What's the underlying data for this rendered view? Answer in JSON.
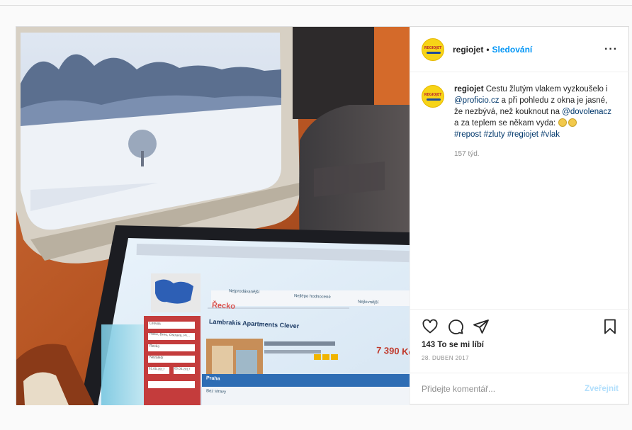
{
  "post": {
    "photo_alt": "",
    "header": {
      "username": "regiojet",
      "separator": "•",
      "follow_label": "Sledování",
      "more_label": "···"
    },
    "avatar_logo_text": "REGIOJET",
    "caption": {
      "username": "regiojet",
      "text_1": " Cestu žlutým vlakem vyzkoušelo i ",
      "mention_1": "@proficio.cz",
      "text_2": " a při pohledu z okna je jasné, že nezbývá, než kouknout na ",
      "mention_2": "@dovolenacz",
      "text_3": " a za teplem se někam vyda: ",
      "hashtags": [
        "#repost",
        "#zluty",
        "#regiojet",
        "#vlak"
      ],
      "age": "157 týd."
    },
    "likes": "143 To se mi líbí",
    "date": "28. DUBEN 2017",
    "comment": {
      "placeholder": "Přidejte komentář...",
      "post_label": "Zveřejnit"
    },
    "photo_screen": {
      "title": "Řecko",
      "hotel": "Lambrakis Apartments Clever",
      "price": "7 390 Kč",
      "tabs": [
        "Nejprodávanější",
        "Nejlépe hodnocené",
        "Nejlevnější"
      ],
      "sidebar_label": "Praha",
      "sidebar_item": "Bez stravy",
      "select_values": [
        "Lesvos",
        "Roku, Brno, Ostrava, Pr...",
        "Řecko",
        "Nezáleží",
        "01.05.2017",
        "05.05.2017"
      ]
    },
    "colors": {
      "accent": "#0095f6",
      "hashtag": "#00376b",
      "muted": "#8e8e8e",
      "brand_yellow": "#f7d417"
    }
  }
}
